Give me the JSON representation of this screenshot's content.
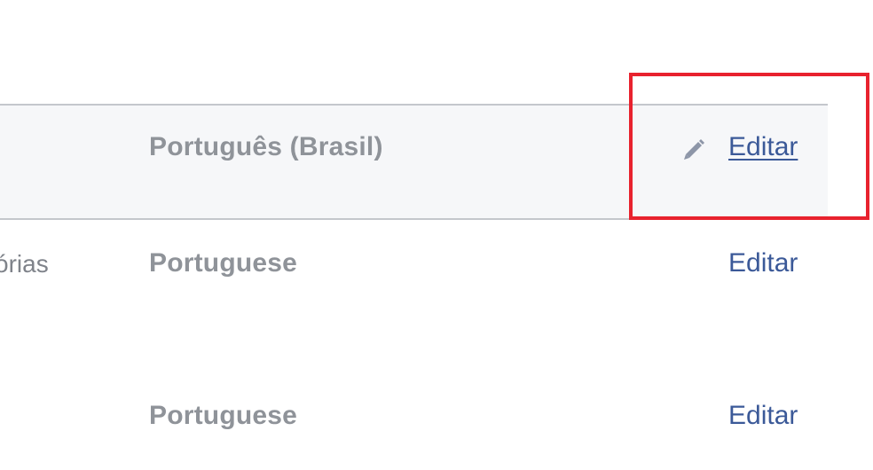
{
  "rows": [
    {
      "setting_label": "",
      "value": "Português (Brasil)",
      "action_label": "Editar",
      "icon": "pencil-icon",
      "hovered": true
    },
    {
      "setting_label": "órias",
      "value": "Portuguese",
      "action_label": "Editar"
    },
    {
      "setting_label": "",
      "value": "Portuguese",
      "action_label": "Editar"
    }
  ],
  "colors": {
    "link": "#3b5998",
    "value_text": "#8f9399",
    "label_text": "#7f838a",
    "row_highlight_bg": "#f6f7f9",
    "divider": "#c4c7cc",
    "annotation_box": "#e8222e"
  }
}
